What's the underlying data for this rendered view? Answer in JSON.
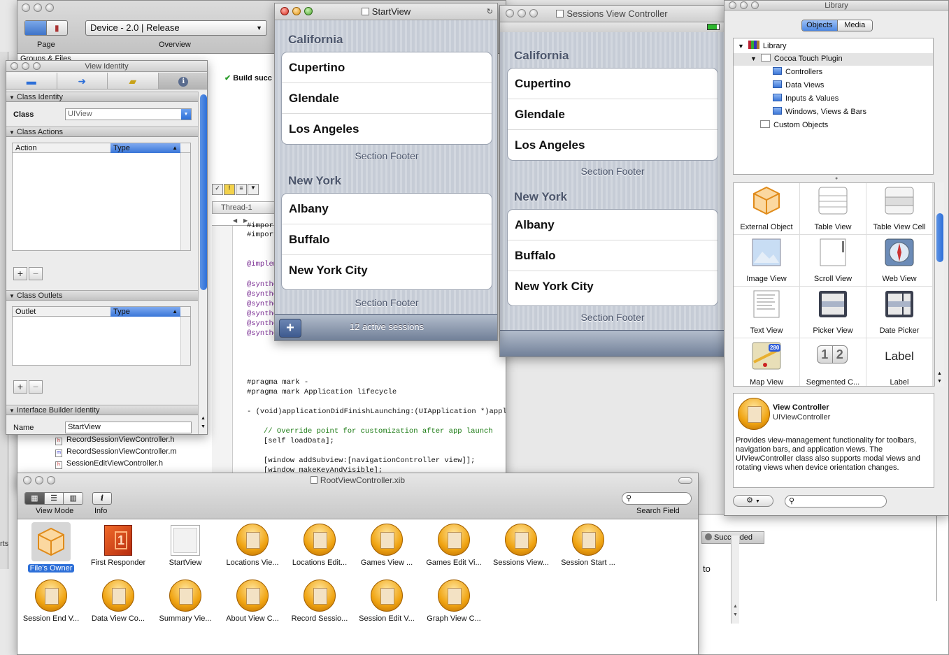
{
  "xcode": {
    "device_selector": "Device - 2.0 | Release",
    "page_label": "Page",
    "overview_label": "Overview",
    "groups_files": "Groups & Files",
    "build_status": "Build succ",
    "thread": "Thread-1",
    "code_lines": [
      {
        "t": "#impor",
        "c": ""
      },
      {
        "t": "#import",
        "c": ""
      },
      {
        "t": "",
        "c": ""
      },
      {
        "t": "@implem",
        "c": "purple"
      },
      {
        "t": "",
        "c": ""
      },
      {
        "t": "@synthe",
        "c": "purple"
      },
      {
        "t": "@synthe",
        "c": "purple"
      },
      {
        "t": "@synthe",
        "c": "purple"
      },
      {
        "t": "@synthe",
        "c": "purple"
      },
      {
        "t": "@synthe",
        "c": "purple"
      },
      {
        "t": "@synthe",
        "c": "purple"
      }
    ],
    "pragma1": "#pragma mark -",
    "pragma2": "#pragma mark Application lifecycle",
    "method_sig": "- (void)applicationDidFinishLaunching:(UIApplication *)application {",
    "comment": "// Override point for customization after app launch",
    "load_data": "[self loadData];",
    "add_subview": "[window addSubview:[navigationController view]];",
    "make_key": "[window makeKeyAndVisible];",
    "files": [
      "RecordSessionViewController.h",
      "RecordSessionViewController.m",
      "SessionEditViewController.h"
    ],
    "succeeded": "Succeeded",
    "partial_text_to": "to",
    "partial_text_rts": "rts"
  },
  "inspector": {
    "title": "View Identity",
    "class_identity": "Class Identity",
    "class_label": "Class",
    "class_value": "UIView",
    "class_actions": "Class Actions",
    "action_col": "Action",
    "type_col": "Type",
    "class_outlets": "Class Outlets",
    "outlet_col": "Outlet",
    "ib_identity": "Interface Builder Identity",
    "name_label": "Name",
    "name_value": "StartView",
    "plus": "+",
    "minus": "−"
  },
  "startview": {
    "title": "StartView",
    "sections": [
      {
        "header": "California",
        "rows": [
          "Cupertino",
          "Glendale",
          "Los Angeles"
        ],
        "footer": "Section Footer"
      },
      {
        "header": "New York",
        "rows": [
          "Albany",
          "Buffalo",
          "New York City"
        ],
        "footer": "Section Footer"
      }
    ],
    "status": "12 active sessions",
    "add": "+"
  },
  "sessions": {
    "title": "Sessions View Controller",
    "sections": [
      {
        "header": "California",
        "rows": [
          "Cupertino",
          "Glendale",
          "Los Angeles"
        ],
        "footer": "Section Footer"
      },
      {
        "header": "New York",
        "rows": [
          "Albany",
          "Buffalo",
          "New York City"
        ],
        "footer": "Section Footer"
      }
    ]
  },
  "library": {
    "title": "Library",
    "tabs": [
      "Objects",
      "Media"
    ],
    "tree": [
      {
        "label": "Library",
        "level": 0
      },
      {
        "label": "Cocoa Touch Plugin",
        "level": 1
      },
      {
        "label": "Controllers",
        "level": 2
      },
      {
        "label": "Data Views",
        "level": 2
      },
      {
        "label": "Inputs & Values",
        "level": 2
      },
      {
        "label": "Windows, Views & Bars",
        "level": 2
      },
      {
        "label": "Custom Objects",
        "level": 1
      }
    ],
    "items": [
      {
        "label": "External Object",
        "icon": "external-object-icon"
      },
      {
        "label": "Table View",
        "icon": "table-view-icon"
      },
      {
        "label": "Table View Cell",
        "icon": "table-view-cell-icon"
      },
      {
        "label": "Image View",
        "icon": "image-view-icon"
      },
      {
        "label": "Scroll View",
        "icon": "scroll-view-icon"
      },
      {
        "label": "Web View",
        "icon": "web-view-icon"
      },
      {
        "label": "Text View",
        "icon": "text-view-icon"
      },
      {
        "label": "Picker View",
        "icon": "picker-view-icon"
      },
      {
        "label": "Date Picker",
        "icon": "date-picker-icon"
      },
      {
        "label": "Map View",
        "icon": "map-view-icon"
      },
      {
        "label": "Segmented C...",
        "icon": "segmented-control-icon"
      },
      {
        "label": "Label",
        "icon": "label-icon"
      }
    ],
    "label_preview": "Label",
    "segment_1": "1",
    "segment_2": "2",
    "map_shield": "280",
    "desc_title": "View Controller",
    "desc_subtitle": "UIViewController",
    "desc_text": "Provides view-management functionality for toolbars, navigation bars, and application views. The UIViewController class also supports modal views and rotating views when device orientation changes."
  },
  "xib": {
    "title": "RootViewController.xib",
    "view_mode": "View Mode",
    "info": "Info",
    "search_field": "Search Field",
    "first_responder_glyph": "1",
    "items": [
      "File's Owner",
      "First Responder",
      "StartView",
      "Locations Vie...",
      "Locations Edit...",
      "Games View ...",
      "Games Edit Vi...",
      "Sessions View...",
      "Session Start ...",
      "Session End V...",
      "Data View Co...",
      "Summary Vie...",
      "About View C...",
      "Record Sessio...",
      "Session Edit V...",
      "Graph View C..."
    ]
  },
  "colors": {
    "selection": "#2d6fd8",
    "ios_toolbar": "#6d7c95",
    "orb": "#f0a412"
  }
}
